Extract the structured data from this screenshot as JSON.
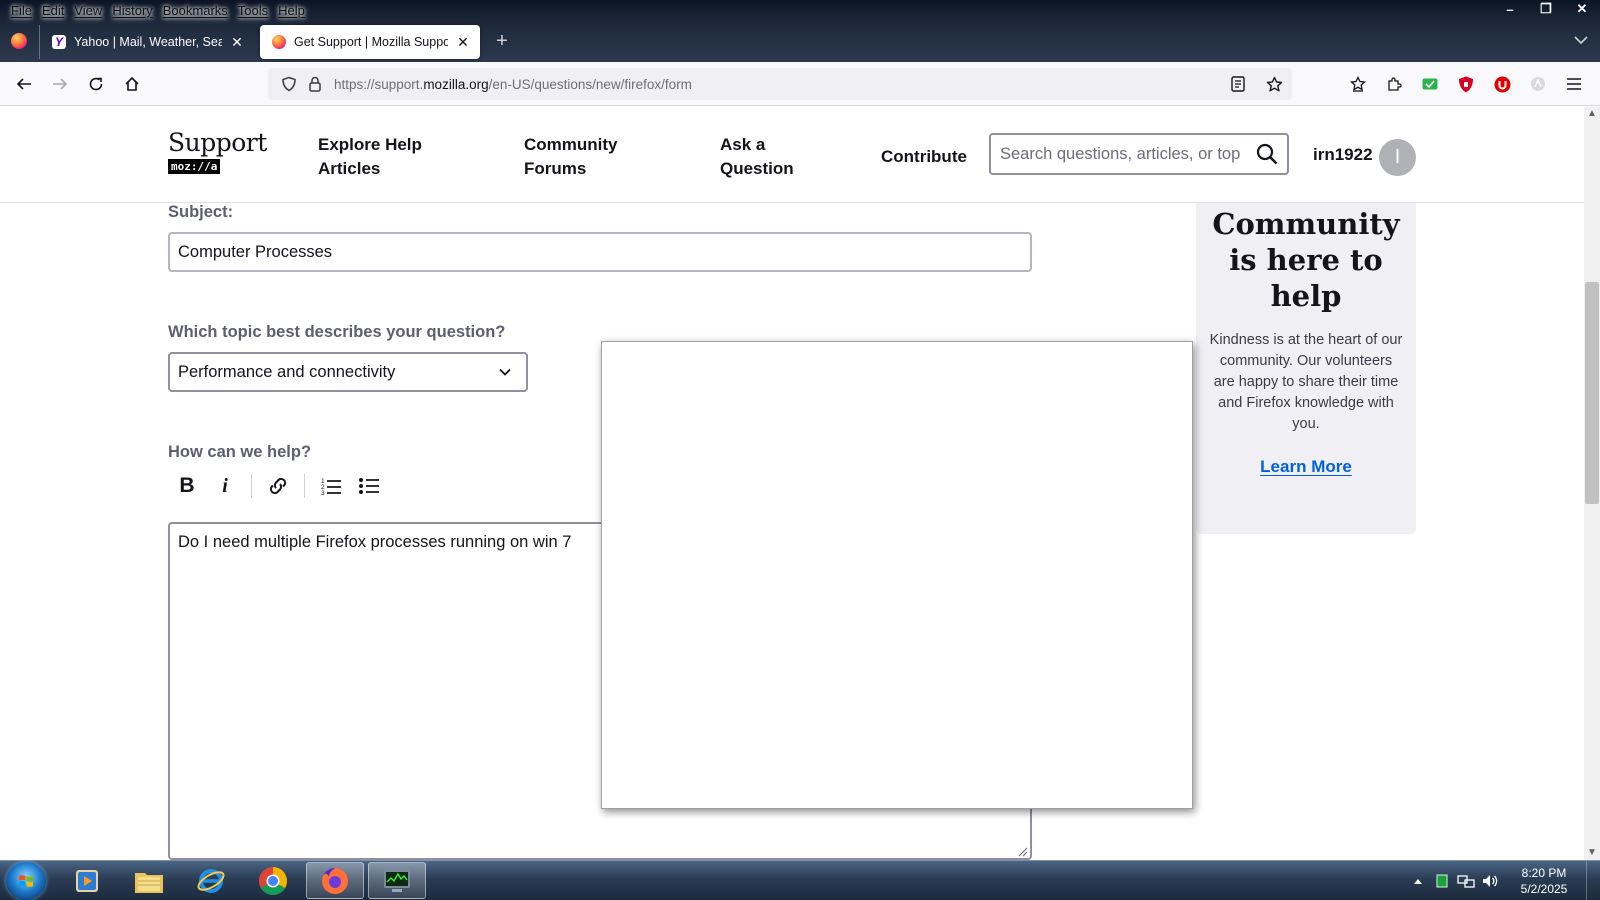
{
  "browser": {
    "menu": [
      "File",
      "Edit",
      "View",
      "History",
      "Bookmarks",
      "Tools",
      "Help"
    ],
    "window_controls": {
      "minimize": "–",
      "restore": "❐",
      "close": "✕"
    },
    "tabs": [
      {
        "title": "Yahoo | Mail, Weather, Search, P",
        "active": false,
        "favicon": "yahoo-icon"
      },
      {
        "title": "Get Support | Mozilla Support",
        "active": true,
        "favicon": "firefox-icon"
      }
    ],
    "new_tab": "+",
    "url": {
      "prefix": "https://support.",
      "domain": "mozilla.org",
      "path": "/en-US/questions/new/firefox/form"
    }
  },
  "site": {
    "logo": {
      "word": "Support",
      "tag": "moz://a"
    },
    "nav": [
      "Explore Help Articles",
      "Community Forums",
      "Ask a Question",
      "Contribute"
    ],
    "search_placeholder": "Search questions, articles, or top",
    "username": "irn1922",
    "avatar_initial": "I"
  },
  "form": {
    "subject_label": "Subject:",
    "subject_value": "Computer Processes",
    "topic_label": "Which topic best describes your question?",
    "topic_value": "Performance and connectivity",
    "help_label": "How can we help?",
    "help_value": "Do I need multiple Firefox processes running on win 7",
    "toolbar": [
      "bold-icon",
      "italic-icon",
      "link-icon",
      "numbered-list-icon",
      "bulleted-list-icon"
    ]
  },
  "sidebar": {
    "title": "Community is here to help",
    "body": "Kindness is at the heart of our community. Our volunteers are happy to share their time and Firefox knowledge with you.",
    "link": "Learn More"
  },
  "taskbar": {
    "apps": [
      "windows-media-player-icon",
      "file-explorer-icon",
      "internet-explorer-icon",
      "chrome-icon",
      "firefox-icon",
      "task-manager-icon"
    ],
    "time": "8:20 PM",
    "date": "5/2/2025"
  },
  "colors": {
    "link": "#0060df",
    "label": "#5e5e72",
    "sidebar_bg": "#f0f0f4"
  }
}
